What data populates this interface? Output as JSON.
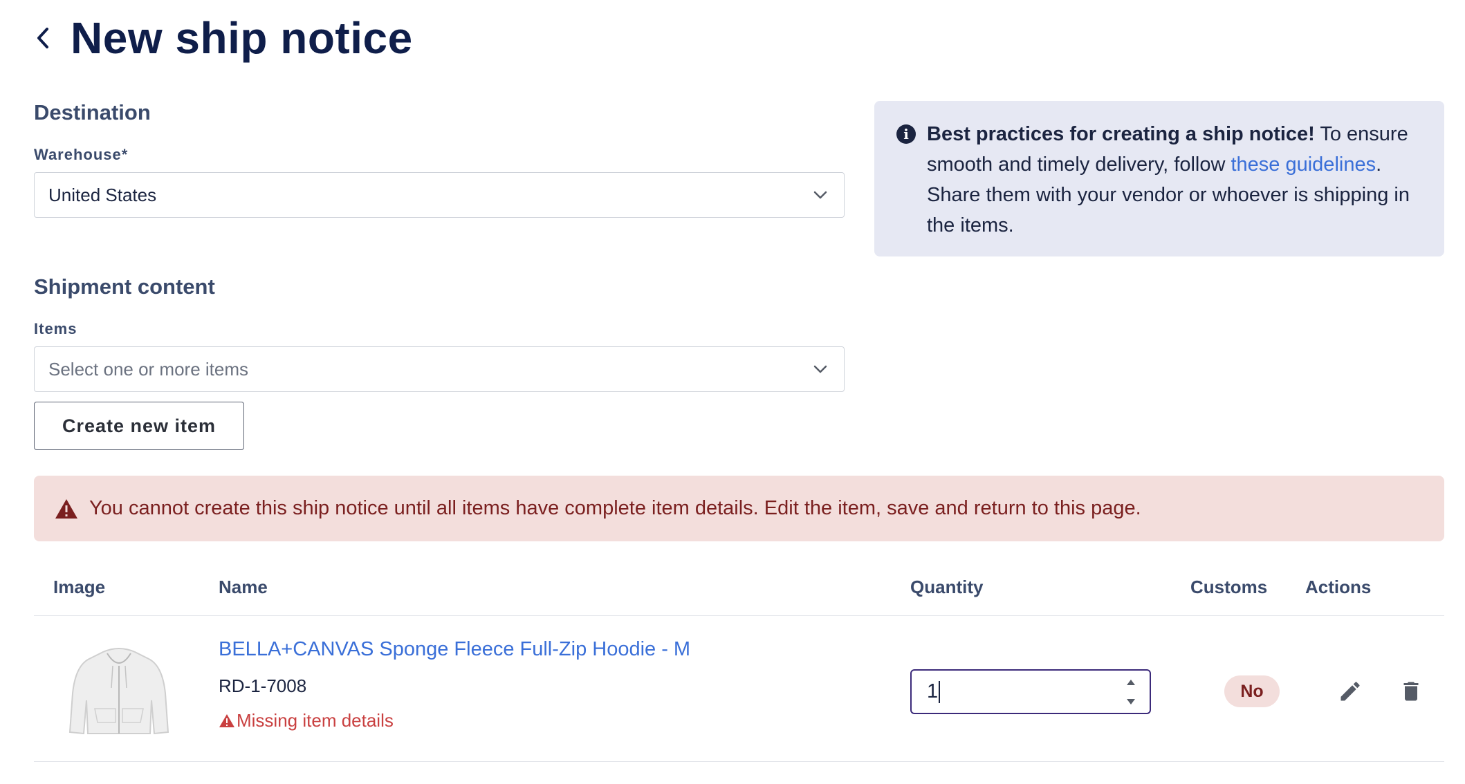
{
  "header": {
    "title": "New ship notice",
    "back_icon": "chevron-left-icon"
  },
  "destination": {
    "section_title": "Destination",
    "warehouse_label": "Warehouse*",
    "warehouse_value": "United States"
  },
  "shipment": {
    "section_title": "Shipment content",
    "items_label": "Items",
    "items_placeholder": "Select one or more items",
    "create_button": "Create new item"
  },
  "info": {
    "icon": "info-icon",
    "bold": "Best practices for creating a ship notice!",
    "text_1": " To ensure smooth and timely delivery, follow ",
    "link": "these guidelines",
    "text_2": ". Share them with your vendor or whoever is shipping in the items."
  },
  "alert": {
    "icon": "warning-icon",
    "message": "You cannot create this ship notice until all items have complete item details. Edit the item, save and return to this page.",
    "bg_color": "#f3dedc",
    "text_color": "#7a1f1f"
  },
  "table": {
    "columns": [
      "Image",
      "Name",
      "Quantity",
      "Customs",
      "Actions"
    ],
    "rows": [
      {
        "image": "hoodie-thumbnail",
        "name": "BELLA+CANVAS Sponge Fleece Full-Zip Hoodie - M",
        "sku": "RD-1-7008",
        "missing": "Missing item details",
        "quantity": "1",
        "customs": "No",
        "actions": [
          "edit-icon",
          "delete-icon"
        ]
      }
    ]
  },
  "colors": {
    "title": "#0f1e4a",
    "link": "#3a6fd8",
    "info_bg": "#e6e8f3",
    "focus_border": "#3b2a7a"
  }
}
